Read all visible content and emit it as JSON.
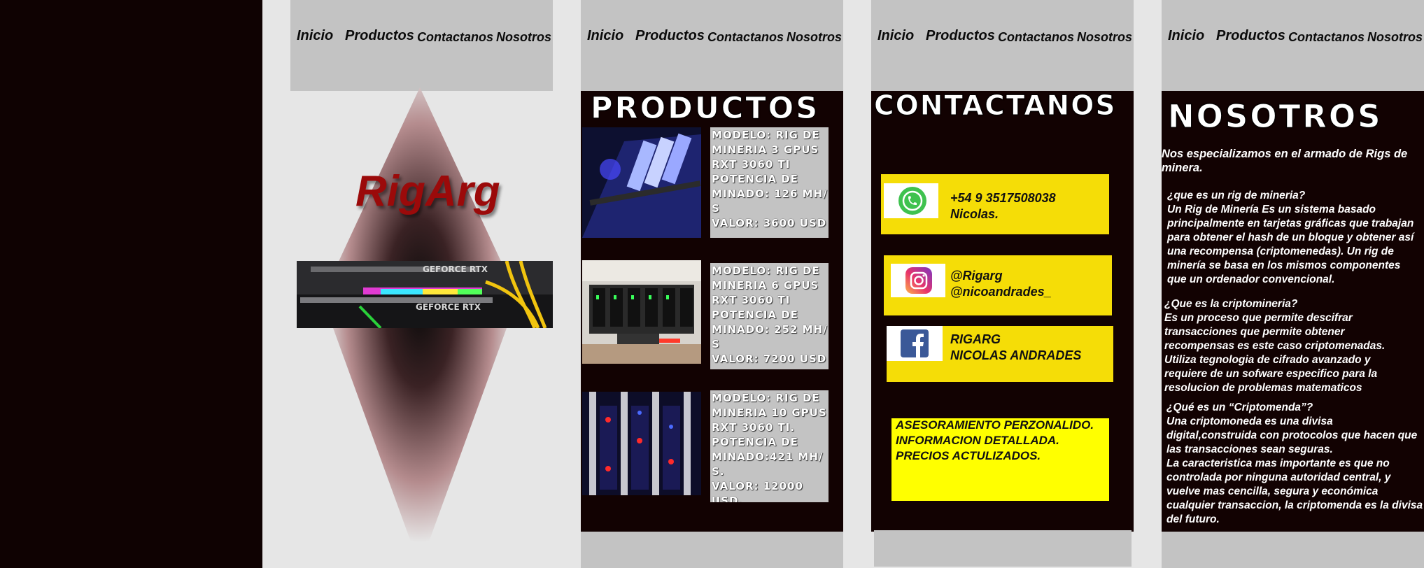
{
  "nav": {
    "inicio": "Inicio",
    "productos": "Productos",
    "contactanos": "Contactanos",
    "nosotros": "Nosotros"
  },
  "home": {
    "brand": "RigArg"
  },
  "productos": {
    "title": "PRODUCTOS",
    "cards": [
      {
        "lines": [
          "MODELO: RIG DE",
          "MINERIA 3 GPUS",
          "RXT 3060 TI",
          "POTENCIA DE",
          "MINADO: 126 MH/",
          "S",
          "VALOR: 3600 USD"
        ]
      },
      {
        "lines": [
          "MODELO: RIG DE",
          "MINERIA 6 GPUS",
          "RXT 3060 TI",
          "POTENCIA DE",
          "MINADO: 252 MH/",
          "S",
          "VALOR: 7200 USD"
        ]
      },
      {
        "lines": [
          "MODELO: RIG DE",
          "MINERIA 10  GPUS",
          "RXT 3060 TI.",
          "POTENCIA DE",
          "MINADO:421 MH/",
          "S.",
          "VALOR: 12000",
          "USD."
        ]
      }
    ]
  },
  "contactanos": {
    "title": "CONTACTANOS",
    "whatsapp": [
      "+54 9 3517508038",
      "Nicolas."
    ],
    "instagram": [
      "@Rigarg",
      "@nicoandrades_"
    ],
    "facebook": [
      "RIGARG",
      "NICOLAS ANDRADES"
    ],
    "info": [
      "ASESORAMIENTO PERZONALIDO.",
      "INFORMACION DETALLADA.",
      "PRECIOS ACTULIZADOS."
    ]
  },
  "nosotros": {
    "title": "NOSOTROS",
    "intro": [
      "Nos especializamos en el armado de Rigs de",
      "minera."
    ],
    "p1": [
      "¿que es un rig de mineria?",
      "Un Rig de Minería  Es un sistema basado",
      "principalmente en tarjetas gráficas que trabajan",
      "para obtener el hash de un bloque y obtener así",
      "una recompensa (criptomenedas). Un rig de",
      "minería se basa en los mismos componentes",
      "que un ordenador convencional."
    ],
    "p2": [
      "¿Que es la criptomineria?",
      "Es un proceso que permite descifrar",
      "transacciones que permite obtener",
      "recompensas es este caso criptomenadas.",
      "Utiliza tegnologia de cifrado avanzado y",
      "requiere de un sofware especifico para la",
      "resolucion de problemas matematicos"
    ],
    "p3": [
      "¿Qué es un “Criptomenda”?",
      "Una criptomoneda es una divisa",
      "digital,construida con protocolos que hacen que",
      "las transacciones sean seguras.",
      "La caracteristica mas importante es que no",
      "controlada por ninguna autoridad central, y",
      "vuelve mas cencilla, segura y económica",
      "cualquier transaccion, la criptomenda es la divisa",
      "del futuro."
    ]
  },
  "colors": {
    "dark": "#120202",
    "gray": "#c3c3c3",
    "yellow": "#f5dd07",
    "brand": "#9b0a0a"
  }
}
